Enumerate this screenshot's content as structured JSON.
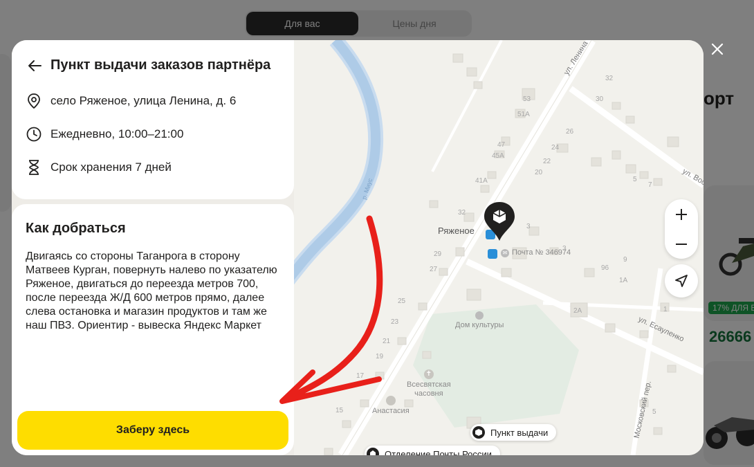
{
  "background": {
    "tabs": [
      {
        "label": "Для вас",
        "active": true
      },
      {
        "label": "Цены дня",
        "active": false
      }
    ],
    "heading_fragment": "орт",
    "badge": "17% ДЛЯ В",
    "price": "26666"
  },
  "modal": {
    "title": "Пункт выдачи заказов партнёра",
    "address": "село Ряженое, улица Ленина, д. 6",
    "hours": "Ежедневно, 10:00–21:00",
    "storage": "Срок хранения 7 дней",
    "route_title": "Как добраться",
    "route_text": "Двигаясь со стороны Таганрога в сторону Матвеев Курган, повернуть налево по указателю Ряженое, двигаться до переезда метров 700, после переезда Ж/Д 600 метров прямо, далее слева остановка и магазин продуктов и там же наш ПВЗ. Ориентир - вывеска Яндекс Маркет",
    "pick_button": "Заберу здесь"
  },
  "map": {
    "village": "Ряженое",
    "river": "р. Миус",
    "post_office": "Почта № 346974",
    "culture_house": "Дом культуры",
    "chapel_line1": "Всесвятская",
    "chapel_line2": "часовня",
    "shop": "Анастасия",
    "streets": {
      "lenina": "ул. Ленина",
      "vos": "ул. Вос",
      "esaulenko": "ул. Есауленко",
      "moskovsky": "Московский пер."
    },
    "house_numbers": [
      "53",
      "51А",
      "47",
      "45А",
      "41А",
      "32",
      "29",
      "27",
      "24",
      "22",
      "20",
      "26",
      "30",
      "32",
      "3",
      "5",
      "7",
      "9",
      "1А",
      "2А",
      "1",
      "96",
      "3",
      "23",
      "21",
      "19",
      "17",
      "15",
      "25",
      "5"
    ],
    "legend": {
      "pickup": "Пункт выдачи",
      "post": "Отделение Почты России"
    }
  }
}
